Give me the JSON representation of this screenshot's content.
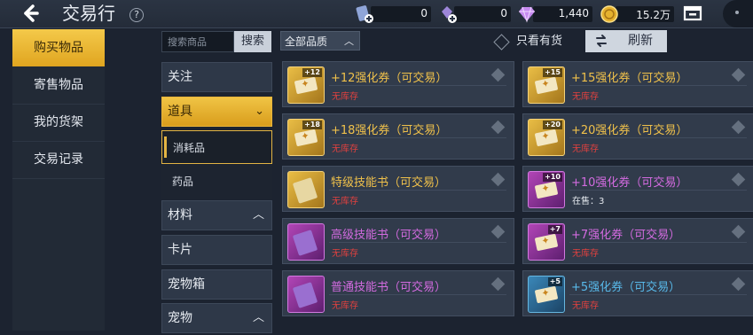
{
  "header": {
    "back_icon": "back-arrow-icon",
    "title": "交易行",
    "help_label": "?",
    "currencies": [
      {
        "icon": "card-plus-icon",
        "value": "0"
      },
      {
        "icon": "gem-plus-icon",
        "value": "0"
      },
      {
        "icon": "diamond-icon",
        "value": "1,440"
      },
      {
        "icon": "gold-coin-icon",
        "value": "15.2万"
      }
    ],
    "mail_icon": "mailbox-icon"
  },
  "left_nav": {
    "items": [
      {
        "label": "购买物品",
        "active": true
      },
      {
        "label": "寄售物品",
        "active": false
      },
      {
        "label": "我的货架",
        "active": false
      },
      {
        "label": "交易记录",
        "active": false
      }
    ]
  },
  "search": {
    "placeholder": "搜索商品",
    "button_label": "搜索"
  },
  "categories": [
    {
      "label": "关注",
      "chevron": ""
    },
    {
      "label": "道具",
      "chevron": "⌄",
      "open": true
    },
    {
      "label": "消耗品",
      "sub": true,
      "selected": true
    },
    {
      "label": "药品",
      "sub": true
    },
    {
      "label": "材料",
      "chevron": "︿"
    },
    {
      "label": "卡片",
      "chevron": ""
    },
    {
      "label": "宠物箱",
      "chevron": ""
    },
    {
      "label": "宠物",
      "chevron": "︿"
    }
  ],
  "filters": {
    "quality_label": "全部品质",
    "quality_chevron": "︿",
    "only_in_stock_label": "只看有货",
    "refresh_label": "刷新"
  },
  "items": [
    {
      "name": "+12强化券（可交易）",
      "status": "无库存",
      "tag": "+12",
      "quality": "gold",
      "kind": "ticket",
      "in_stock": false
    },
    {
      "name": "+15强化券（可交易）",
      "status": "无库存",
      "tag": "+15",
      "quality": "gold",
      "kind": "ticket",
      "in_stock": false
    },
    {
      "name": "+18强化券（可交易）",
      "status": "无库存",
      "tag": "+18",
      "quality": "gold",
      "kind": "ticket",
      "in_stock": false
    },
    {
      "name": "+20强化券（可交易）",
      "status": "无库存",
      "tag": "+20",
      "quality": "gold",
      "kind": "ticket",
      "in_stock": false
    },
    {
      "name": "特级技能书（可交易）",
      "status": "无库存",
      "tag": "",
      "quality": "gold",
      "kind": "book",
      "in_stock": false
    },
    {
      "name": "+10强化券（可交易）",
      "status": "在售：3",
      "tag": "+10",
      "quality": "purple",
      "kind": "ticket",
      "in_stock": true
    },
    {
      "name": "高级技能书（可交易）",
      "status": "无库存",
      "tag": "",
      "quality": "purple",
      "kind": "book",
      "in_stock": false
    },
    {
      "name": "+7强化券（可交易）",
      "status": "无库存",
      "tag": "+7",
      "quality": "purple",
      "kind": "ticket",
      "in_stock": false
    },
    {
      "name": "普通技能书（可交易）",
      "status": "无库存",
      "tag": "",
      "quality": "purple",
      "kind": "book",
      "in_stock": false
    },
    {
      "name": "+5强化券（可交易）",
      "status": "无库存",
      "tag": "+5",
      "quality": "blue",
      "kind": "ticket",
      "in_stock": false
    }
  ],
  "colors": {
    "accent_gold": "#f0c14b",
    "quality_purple": "#d36be0",
    "quality_blue": "#58b9ea",
    "out_of_stock_red": "#e0413f"
  }
}
